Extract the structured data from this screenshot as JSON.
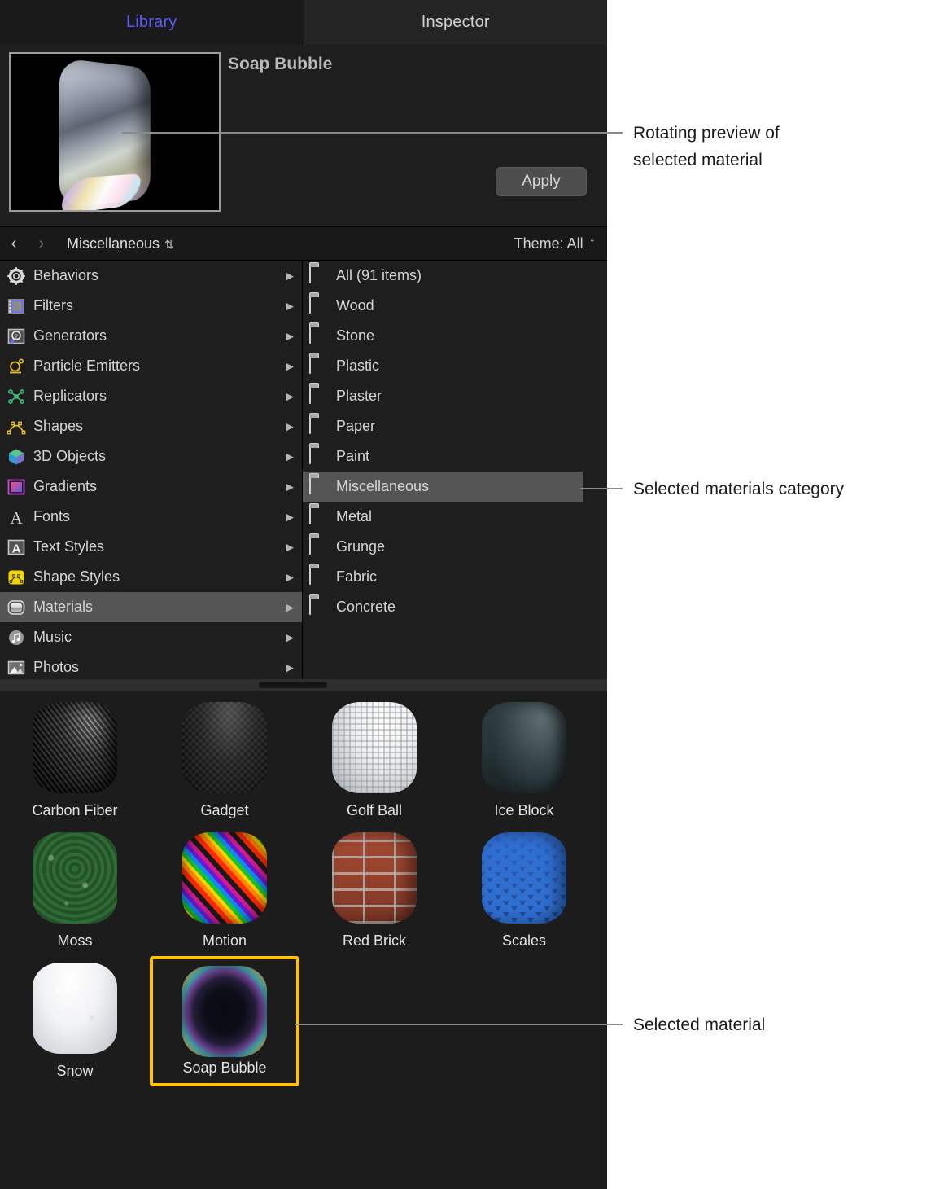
{
  "tabs": [
    {
      "label": "Library",
      "active": true
    },
    {
      "label": "Inspector",
      "active": false
    }
  ],
  "preview": {
    "material_name": "Soap Bubble",
    "apply_label": "Apply",
    "thumbnail_alt": "soap-bubble-rotating-preview"
  },
  "navbar": {
    "back_icon": "‹",
    "forward_icon": "›",
    "breadcrumb": "Miscellaneous",
    "sort_icon": "⇅",
    "theme_label": "Theme: All",
    "theme_chevron": "ˇ"
  },
  "sidebar": {
    "items": [
      {
        "label": "Behaviors",
        "icon": "gear-icon",
        "disclosure": "▶",
        "selected": false
      },
      {
        "label": "Filters",
        "icon": "film-strip-icon",
        "disclosure": "▶",
        "selected": false
      },
      {
        "label": "Generators",
        "icon": "generator-icon",
        "disclosure": "▶",
        "selected": false
      },
      {
        "label": "Particle Emitters",
        "icon": "particle-emitter-icon",
        "disclosure": "▶",
        "selected": false
      },
      {
        "label": "Replicators",
        "icon": "replicator-icon",
        "disclosure": "▶",
        "selected": false
      },
      {
        "label": "Shapes",
        "icon": "shapes-icon",
        "disclosure": "▶",
        "selected": false
      },
      {
        "label": "3D Objects",
        "icon": "cube-icon",
        "disclosure": "▶",
        "selected": false
      },
      {
        "label": "Gradients",
        "icon": "gradient-icon",
        "disclosure": "▶",
        "selected": false
      },
      {
        "label": "Fonts",
        "icon": "letter-a-icon",
        "disclosure": "▶",
        "selected": false
      },
      {
        "label": "Text Styles",
        "icon": "text-style-icon",
        "disclosure": "▶",
        "selected": false
      },
      {
        "label": "Shape Styles",
        "icon": "shape-style-icon",
        "disclosure": "▶",
        "selected": false
      },
      {
        "label": "Materials",
        "icon": "material-icon",
        "disclosure": "▶",
        "selected": true
      },
      {
        "label": "Music",
        "icon": "music-note-icon",
        "disclosure": "▶",
        "selected": false
      },
      {
        "label": "Photos",
        "icon": "photo-icon",
        "disclosure": "▶",
        "selected": false
      }
    ]
  },
  "categories": {
    "items": [
      {
        "label": "All (91 items)",
        "icon": "folder-icon",
        "selected": false
      },
      {
        "label": "Wood",
        "icon": "folder-icon",
        "selected": false
      },
      {
        "label": "Stone",
        "icon": "folder-icon",
        "selected": false
      },
      {
        "label": "Plastic",
        "icon": "folder-icon",
        "selected": false
      },
      {
        "label": "Plaster",
        "icon": "folder-icon",
        "selected": false
      },
      {
        "label": "Paper",
        "icon": "folder-icon",
        "selected": false
      },
      {
        "label": "Paint",
        "icon": "folder-icon",
        "selected": false
      },
      {
        "label": "Miscellaneous",
        "icon": "folder-icon",
        "selected": true
      },
      {
        "label": "Metal",
        "icon": "folder-icon",
        "selected": false
      },
      {
        "label": "Grunge",
        "icon": "folder-icon",
        "selected": false
      },
      {
        "label": "Fabric",
        "icon": "folder-icon",
        "selected": false
      },
      {
        "label": "Concrete",
        "icon": "folder-icon",
        "selected": false
      }
    ]
  },
  "materials": {
    "items": [
      {
        "label": "Carbon Fiber",
        "swatch": "m-carbon",
        "selected": false
      },
      {
        "label": "Gadget",
        "swatch": "m-gadget",
        "selected": false
      },
      {
        "label": "Golf Ball",
        "swatch": "m-golf",
        "selected": false
      },
      {
        "label": "Ice Block",
        "swatch": "m-ice",
        "selected": false
      },
      {
        "label": "Moss",
        "swatch": "m-moss",
        "selected": false
      },
      {
        "label": "Motion",
        "swatch": "m-motion",
        "selected": false
      },
      {
        "label": "Red Brick",
        "swatch": "m-brick",
        "selected": false
      },
      {
        "label": "Scales",
        "swatch": "m-scales",
        "selected": false
      },
      {
        "label": "Snow",
        "swatch": "m-snow",
        "selected": false
      },
      {
        "label": "Soap Bubble",
        "swatch": "m-soap",
        "selected": true
      }
    ]
  },
  "callouts": [
    {
      "line1": "Rotating preview of",
      "line2": "selected material"
    },
    {
      "line1": "Selected materials category",
      "line2": ""
    },
    {
      "line1": "Selected material",
      "line2": ""
    }
  ],
  "colors": {
    "accent_tab": "#5b5bff",
    "selection_highlight": "#555555",
    "selected_material_border": "#ffc20e",
    "panel_background": "#1c1c1c",
    "callout_line": "#8a8a8a"
  }
}
